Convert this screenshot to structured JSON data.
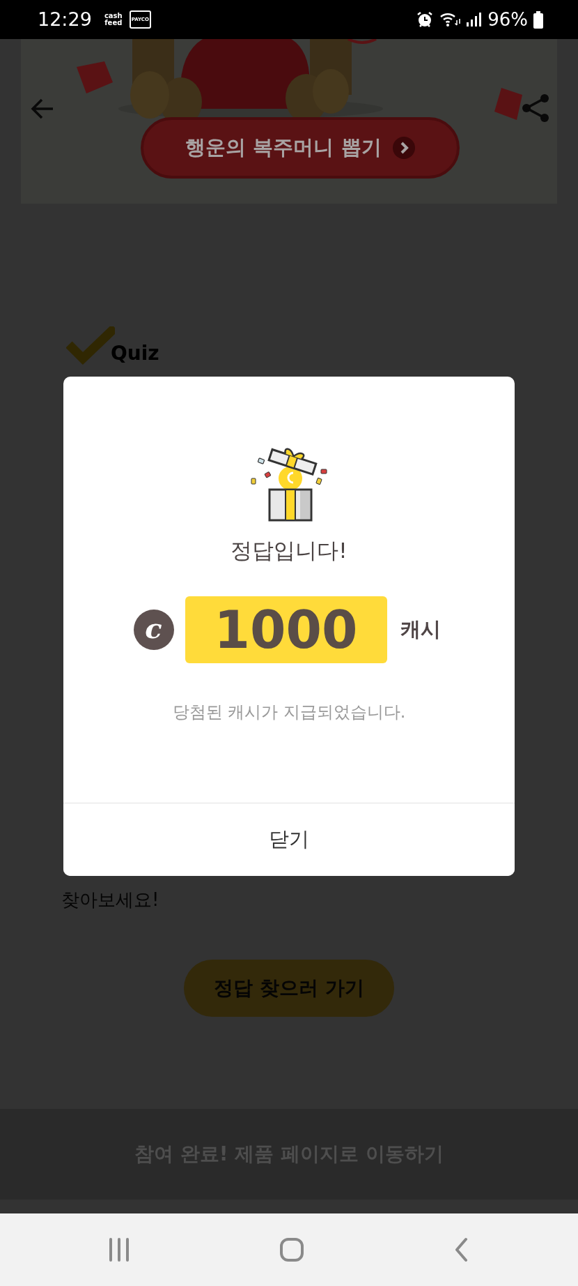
{
  "status_bar": {
    "time": "12:29",
    "notifications": [
      "cash feed",
      "PAYCO"
    ],
    "battery": "96%"
  },
  "banner": {
    "button_label": "행운의 복주머니 뽑기"
  },
  "quiz": {
    "title": "Quiz",
    "instruction_lines": [
      "찾아보세요!"
    ],
    "button": "정답 찾으러 가기"
  },
  "footer_button": "참여 완료! 제품 페이지로 이동하기",
  "dialog": {
    "title": "정답입니다!",
    "coin_symbol": "c",
    "amount": "1000",
    "unit": "캐시",
    "message": "당첨된 캐시가 지급되었습니다.",
    "close": "닫기"
  }
}
